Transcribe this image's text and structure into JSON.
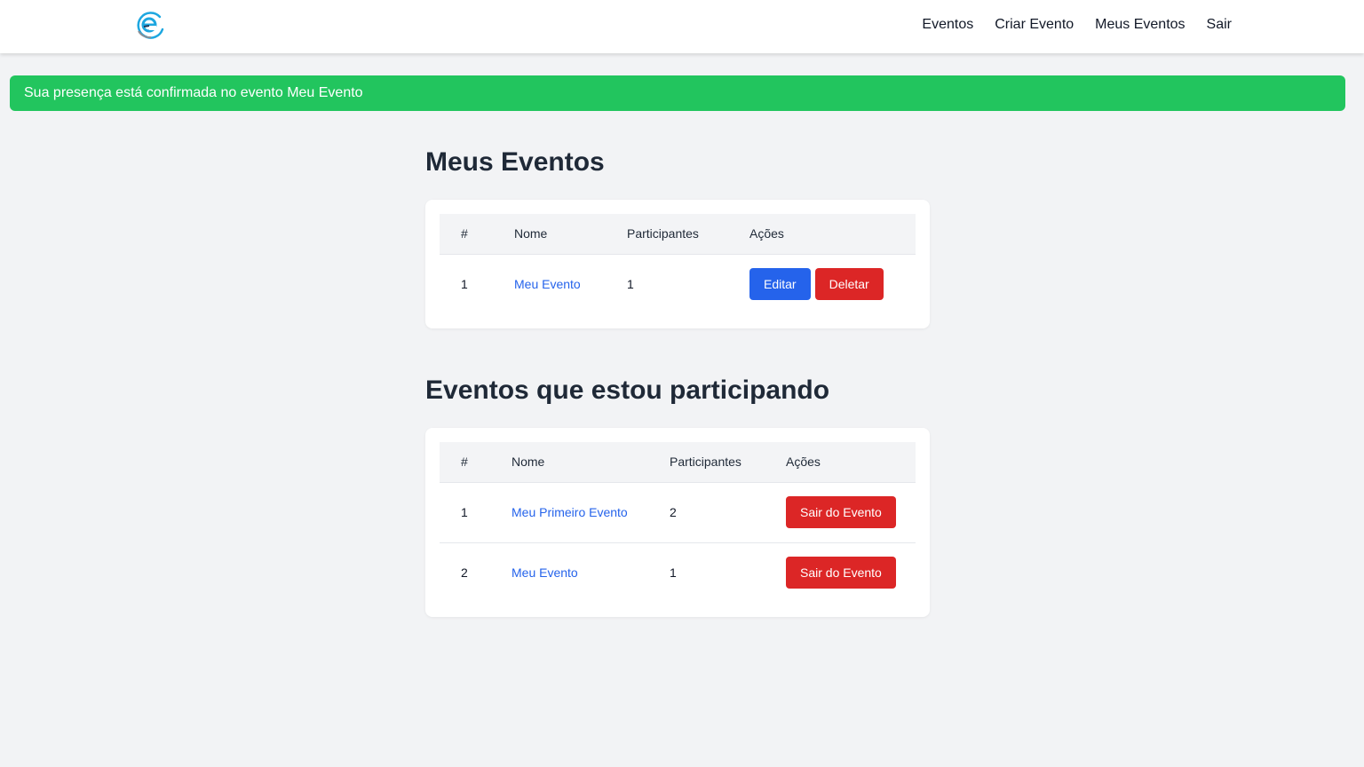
{
  "nav": {
    "logo_icon": "event-logo-icon",
    "links": [
      "Eventos",
      "Criar Evento",
      "Meus Eventos",
      "Sair"
    ]
  },
  "alert": {
    "message": "Sua presença está confirmada no evento Meu Evento",
    "color": "#22c55e"
  },
  "my_events": {
    "title": "Meus Eventos",
    "headers": [
      "#",
      "Nome",
      "Participantes",
      "Ações"
    ],
    "rows": [
      {
        "index": "1",
        "name": "Meu Evento",
        "participants": "1",
        "edit_label": "Editar",
        "delete_label": "Deletar"
      }
    ]
  },
  "participating": {
    "title": "Eventos que estou participando",
    "headers": [
      "#",
      "Nome",
      "Participantes",
      "Ações"
    ],
    "rows": [
      {
        "index": "1",
        "name": "Meu Primeiro Evento",
        "participants": "2",
        "leave_label": "Sair do Evento"
      },
      {
        "index": "2",
        "name": "Meu Evento",
        "participants": "1",
        "leave_label": "Sair do Evento"
      }
    ]
  },
  "colors": {
    "primary": "#2563eb",
    "danger": "#dc2626",
    "success": "#22c55e",
    "background": "#f2f3f5"
  }
}
